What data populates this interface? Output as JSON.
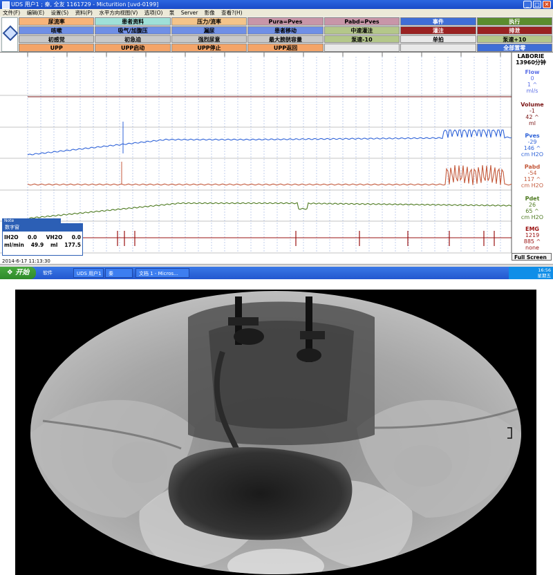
{
  "window": {
    "title": "UDS 用户1 ; 秦, 全友  1161729 - Micturition [uvd-0199]",
    "min": "_",
    "max": "□",
    "close": "✕"
  },
  "menu": [
    "文件(F)",
    "编辑(E)",
    "设置(S)",
    "资料(P)",
    "水平方向视图(V)",
    "选项(O)",
    "泵",
    "Server",
    "影像",
    "查看?(H)"
  ],
  "buttons": [
    [
      {
        "label": "尿流率",
        "bg": "#f7b47a"
      },
      {
        "label": "患者资料",
        "bg": "#9fe0d8"
      },
      {
        "label": "压力/流率",
        "bg": "#f4c48a"
      },
      {
        "label": "Pura=Pves",
        "bg": "#c896a8"
      },
      {
        "label": "Pabd=Pves",
        "bg": "#c896a8"
      },
      {
        "label": "事件",
        "bg": "#3f6ed6"
      },
      {
        "label": "执行",
        "bg": "#5b8c2e"
      }
    ],
    [
      {
        "label": "咳嗽",
        "bg": "#6f8fe6"
      },
      {
        "label": "吸气/加腹压",
        "bg": "#6f8fe6"
      },
      {
        "label": "漏尿",
        "bg": "#6f8fe6"
      },
      {
        "label": "患者移动",
        "bg": "#6f8fe6"
      },
      {
        "label": "中速灌注",
        "bg": "#b4c78a"
      },
      {
        "label": "灌注",
        "bg": "#9a2222"
      },
      {
        "label": "排泄",
        "bg": "#9a2222"
      }
    ],
    [
      {
        "label": "初感觉",
        "bg": "#c9c9c9"
      },
      {
        "label": "初急迫",
        "bg": "#c9c9c9"
      },
      {
        "label": "强烈尿意",
        "bg": "#c9c9c9"
      },
      {
        "label": "最大膀胱容量",
        "bg": "#c9c9c9"
      },
      {
        "label": "泵速-10",
        "bg": "#b4c78a"
      },
      {
        "label": "单拍",
        "bg": "#e9e9e9"
      },
      {
        "label": "泵速+10",
        "bg": "#b4c78a"
      }
    ],
    [
      {
        "label": "UPP",
        "bg": "#f4a468"
      },
      {
        "label": "UPP启动",
        "bg": "#f4a468"
      },
      {
        "label": "UPP停止",
        "bg": "#f4a468"
      },
      {
        "label": "UPP返回",
        "bg": "#f4a468"
      },
      {
        "label": "",
        "bg": "#e9e9e9"
      },
      {
        "label": "",
        "bg": "#e9e9e9"
      },
      {
        "label": "全部置零",
        "bg": "#3f6ed6"
      }
    ]
  ],
  "laborie": {
    "line1": "LABORIE",
    "line2": "13960分钟"
  },
  "channels": [
    {
      "name": "Flow",
      "v1": "0",
      "v2": "1 ^",
      "unit": "ml/s",
      "color": "#5a6ee6"
    },
    {
      "name": "Volume",
      "v1": "-1",
      "v2": "42 ^",
      "unit": "ml",
      "color": "#7a1414"
    },
    {
      "name": "Pves",
      "v1": "-29",
      "v2": "146 ^",
      "unit": "cm H2O",
      "color": "#2f63d8"
    },
    {
      "name": "Pabd",
      "v1": "-54",
      "v2": "117 ^",
      "unit": "cm H2O",
      "color": "#c45a3c"
    },
    {
      "name": "Pdet",
      "v1": "26",
      "v2": "65 ^",
      "unit": "cm H2O",
      "color": "#4d7a20"
    },
    {
      "name": "EMG",
      "v1": "1219",
      "v2": "885 ^",
      "unit": "none",
      "color": "#9a1010"
    }
  ],
  "mini_panel": {
    "small_title": "Note",
    "title": "数字窗",
    "rows": [
      [
        "IH2O",
        "0.0",
        "VH2O",
        "0.0"
      ],
      [
        "ml/min",
        "49.9",
        "ml",
        "177.5"
      ]
    ]
  },
  "timestamp": "2014-6-17 11:13:30",
  "fullscreen": "Full Screen",
  "taskbar": {
    "start": "开始",
    "tasks": [
      "软件",
      "UDS 用户1",
      "秦",
      "文档 1 - Micros..."
    ],
    "clock": "16:56",
    "day": "星期五"
  },
  "colors": {
    "accent": "#2c5fb5",
    "flow": "#5a6ee6",
    "volume": "#7a1414",
    "pves": "#2f63d8",
    "pabd": "#c45a3c",
    "pdet": "#4d7a20",
    "emg": "#9a1010"
  }
}
